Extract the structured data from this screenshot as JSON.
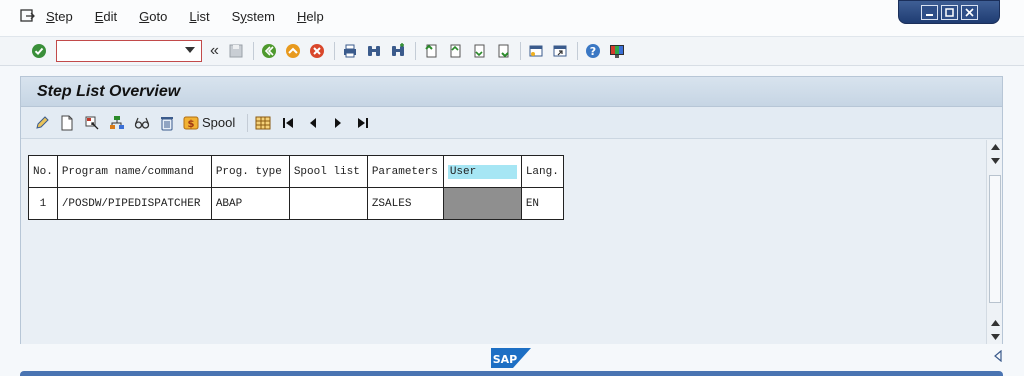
{
  "menu": {
    "items": [
      {
        "label": "Step",
        "accel": "S"
      },
      {
        "label": "Edit",
        "accel": "E"
      },
      {
        "label": "Goto",
        "accel": "G"
      },
      {
        "label": "List",
        "accel": "L"
      },
      {
        "label": "System",
        "accel": "y"
      },
      {
        "label": "Help",
        "accel": "H"
      }
    ]
  },
  "toolbar": {
    "command_value": "",
    "more_glyph": "«"
  },
  "panel": {
    "title": "Step List Overview",
    "spool_label": "Spool"
  },
  "table": {
    "headers": [
      "No.",
      "Program name/command",
      "Prog. type",
      "Spool list",
      "Parameters",
      "User",
      "Lang."
    ],
    "rows": [
      {
        "no": "1",
        "program": "/POSDW/PIPEDISPATCHER",
        "prog_type": "ABAP",
        "spool": "",
        "params": "ZSALES",
        "user": "",
        "lang": "EN"
      }
    ]
  },
  "footer": {
    "logo_text": "SAP"
  },
  "colors": {
    "header_highlight": "#a6e6f4",
    "title_bar": "#c6d5e4",
    "window_controls": "#1f3c72"
  }
}
